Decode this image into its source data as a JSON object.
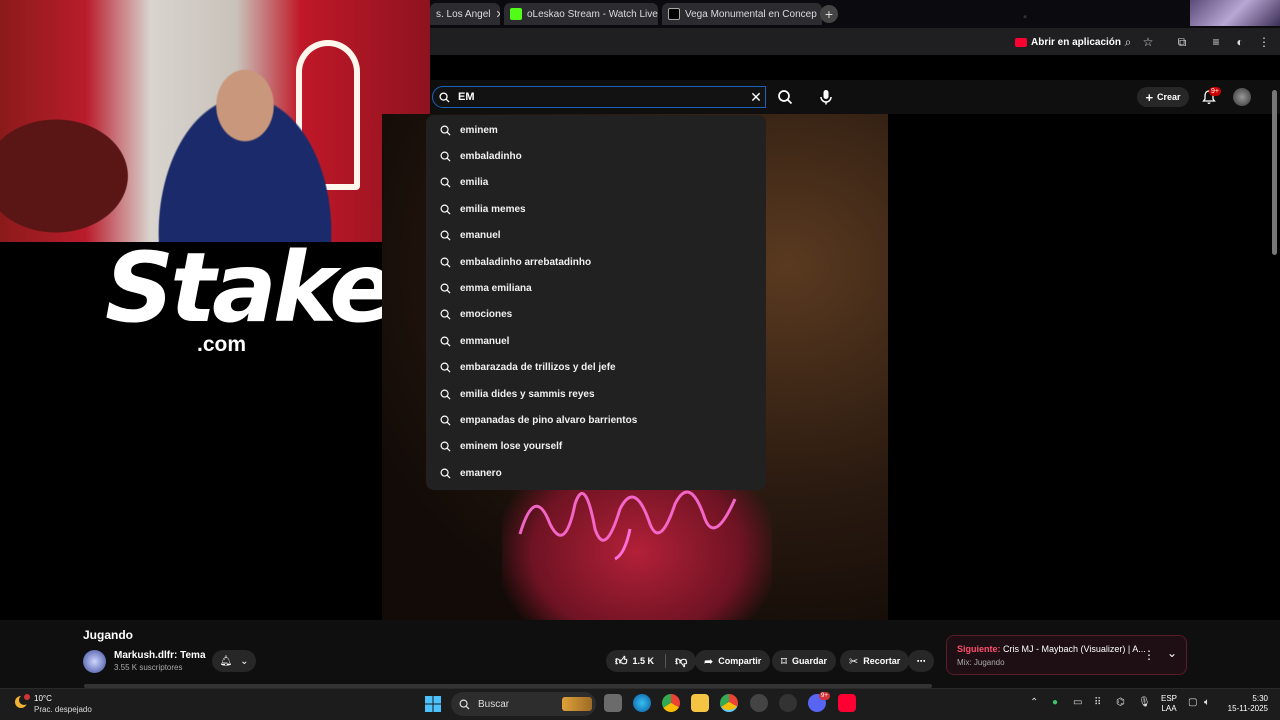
{
  "browser": {
    "tabs": [
      {
        "label": "s. Los Angel",
        "icon": "tab-favicon"
      },
      {
        "label": "oLeskao Stream - Watch Live o",
        "icon": "kick-icon",
        "color": "#53fc18"
      },
      {
        "label": "Vega Monumental en Concep",
        "icon": "tiktok-icon"
      }
    ],
    "open_in_app_label": "Abrir en aplicación"
  },
  "search": {
    "value": "EM",
    "suggestions": [
      "eminem",
      "embaladinho",
      "emilia",
      "emilia memes",
      "emanuel",
      "embaladinho arrebatadinho",
      "emma emiliana",
      "emociones",
      "emmanuel",
      "embarazada de trillizos y del jefe",
      "emilia dides y sammis reyes",
      "empanadas de pino alvaro barrientos",
      "eminem lose yourself",
      "emanero"
    ]
  },
  "header": {
    "create_label": "Crear",
    "notification_badge": "9+"
  },
  "overlay": {
    "brand": "Stake",
    "brand_suffix": ".com"
  },
  "video": {
    "title": "Jugando",
    "channel_name": "Markush.dlfr: Tema",
    "subscribers": "3.55 K suscriptores",
    "likes": "1.5 K",
    "share_label": "Compartir",
    "save_label": "Guardar",
    "clip_label": "Recortar"
  },
  "up_next": {
    "label": "Siguiente:",
    "title": "Cris MJ - Maybach (Visualizer) | A...",
    "subtitle": "Mix: Jugando"
  },
  "taskbar": {
    "temperature": "10°C",
    "weather": "Prac. despejado",
    "search_label": "Buscar",
    "lang_line1": "ESP",
    "lang_line2": "LAA",
    "time": "5:30",
    "date": "15-11-2025",
    "discord_badge": "9+"
  },
  "colors": {
    "accent_blue": "#1c62b9",
    "youtube_red": "#ff0033",
    "next_label": "#ff4e6e"
  }
}
